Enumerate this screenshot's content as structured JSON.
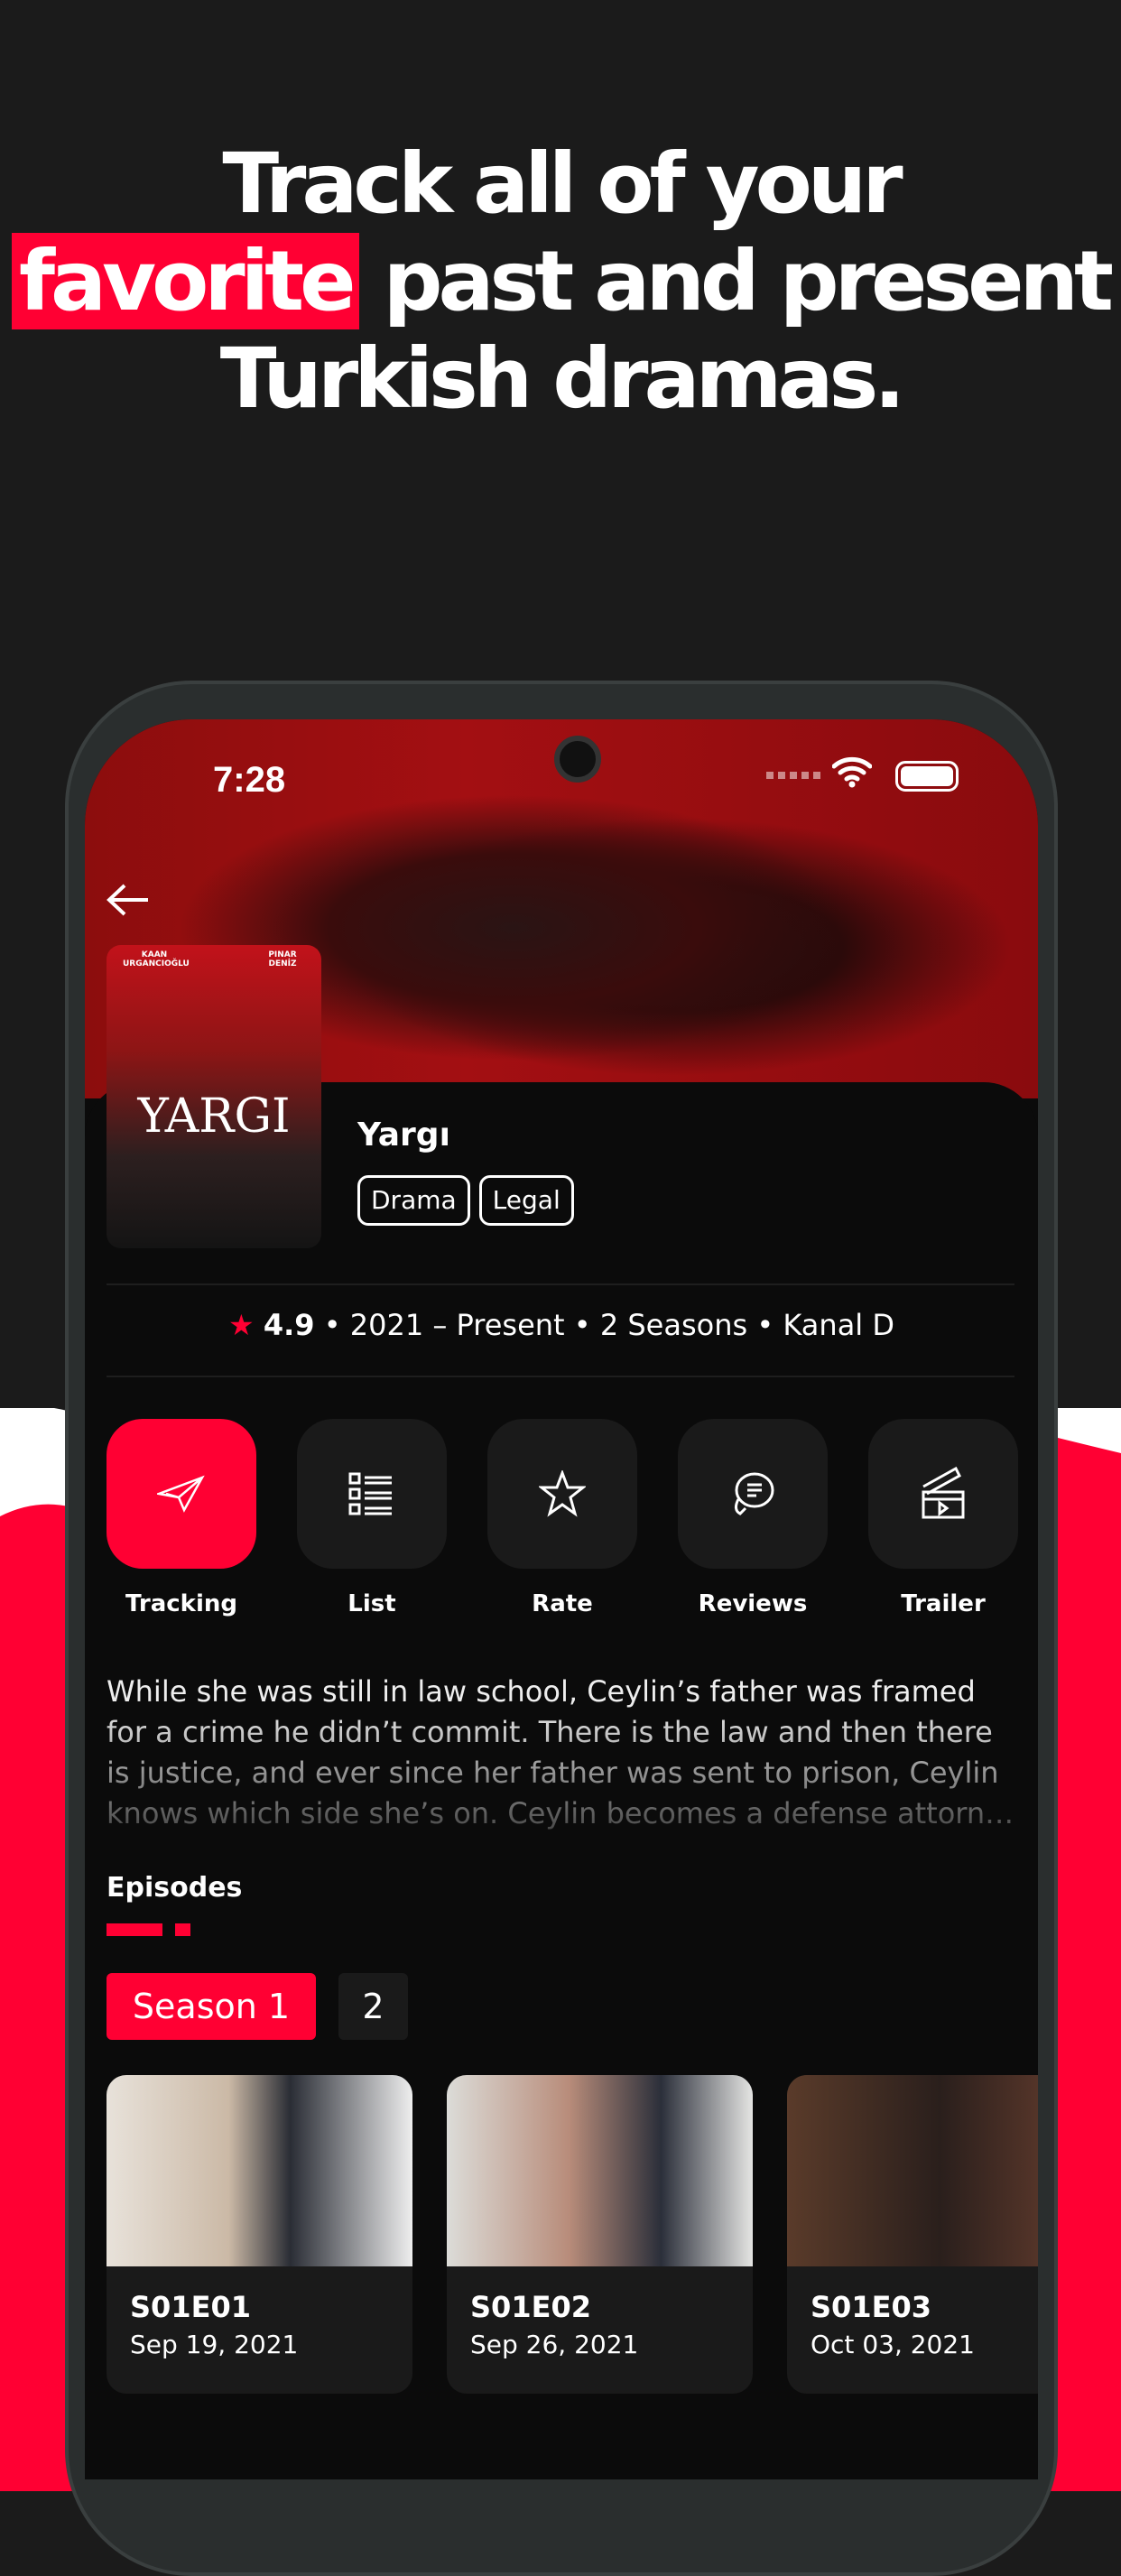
{
  "headline": {
    "before": "Track all of your",
    "highlight": "favorite",
    "after": "past and present Turkish dramas."
  },
  "colors": {
    "accent": "#ff0033",
    "background": "#1b1b1b",
    "screen": "#0b0b0b"
  },
  "status_bar": {
    "time": "7:28",
    "icons": [
      "wifi-icon",
      "battery-icon"
    ]
  },
  "show": {
    "title": "Yargı",
    "tags": [
      "Drama",
      "Legal"
    ],
    "rating": "4.9",
    "years": "2021 – Present",
    "seasons": "2 Seasons",
    "network": "Kanal D",
    "poster_text": {
      "actor1": "KAAN URGANCIOĞLU",
      "actor2": "PINAR DENİZ",
      "logo": "YARGI"
    }
  },
  "actions": [
    {
      "label": "Tracking",
      "icon": "paper-plane-icon",
      "active": true
    },
    {
      "label": "List",
      "icon": "checklist-icon"
    },
    {
      "label": "Rate",
      "icon": "star-icon"
    },
    {
      "label": "Reviews",
      "icon": "chat-bubbles-icon"
    },
    {
      "label": "Trailer",
      "icon": "clapperboard-icon"
    }
  ],
  "description": "While she was still in law school, Ceylin’s father was framed for a crime he didn’t commit. There is the law and then there is justice, and ever since her father was sent to prison, Ceylin knows which side she’s on. Ceylin becomes a defense attorn…",
  "episodes": {
    "heading": "Episodes",
    "seasons": [
      "Season 1",
      "2"
    ],
    "items": [
      {
        "code": "S01E01",
        "date": "Sep 19, 2021"
      },
      {
        "code": "S01E02",
        "date": "Sep 26, 2021"
      },
      {
        "code": "S01E03",
        "date": "Oct 03, 2021"
      }
    ]
  }
}
